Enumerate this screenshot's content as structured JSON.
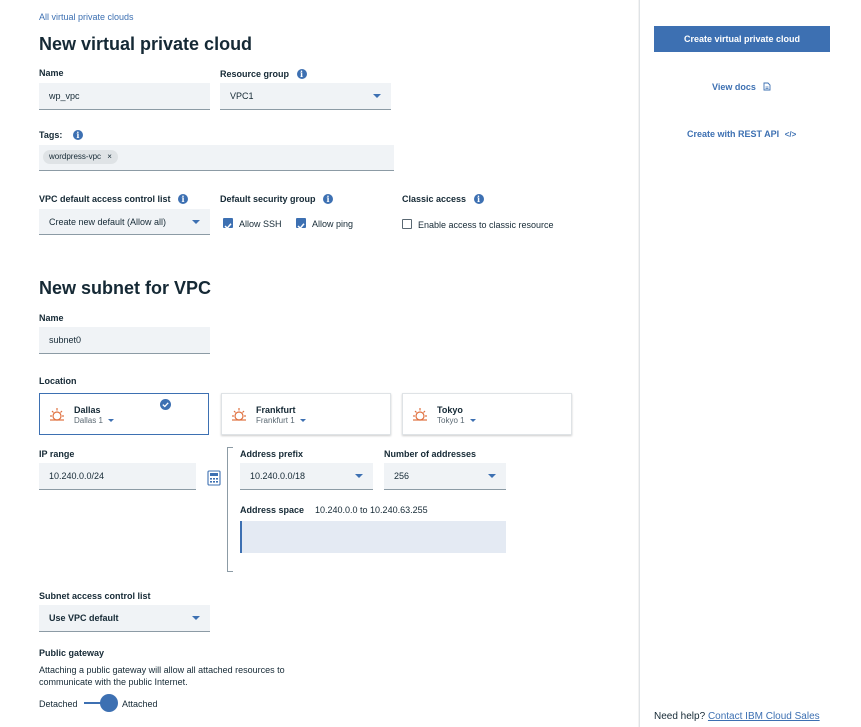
{
  "breadcrumb": "All virtual private clouds",
  "page_title": "New virtual private cloud",
  "vpc": {
    "name_label": "Name",
    "name_value": "wp_vpc",
    "resource_group_label": "Resource group",
    "resource_group_value": "VPC1",
    "tags_label": "Tags:",
    "tags": [
      "wordpress-vpc"
    ],
    "acl_label": "VPC default access control list",
    "acl_value": "Create new default (Allow all)",
    "security_group_label": "Default security group",
    "allow_ssh_label": "Allow SSH",
    "allow_ssh_checked": true,
    "allow_ping_label": "Allow ping",
    "allow_ping_checked": true,
    "classic_label": "Classic access",
    "classic_option_label": "Enable access to classic resource",
    "classic_checked": false
  },
  "subnet": {
    "section_title": "New subnet for VPC",
    "name_label": "Name",
    "name_value": "subnet0",
    "location_label": "Location",
    "locations": [
      {
        "city": "Dallas",
        "zone": "Dallas 1",
        "selected": true
      },
      {
        "city": "Frankfurt",
        "zone": "Frankfurt 1",
        "selected": false
      },
      {
        "city": "Tokyo",
        "zone": "Tokyo 1",
        "selected": false
      }
    ],
    "ip_range_label": "IP range",
    "ip_range_value": "10.240.0.0/24",
    "address_prefix_label": "Address prefix",
    "address_prefix_value": "10.240.0.0/18",
    "num_addresses_label": "Number of addresses",
    "num_addresses_value": "256",
    "address_space_label": "Address space",
    "address_space_value": "10.240.0.0 to 10.240.63.255",
    "acl_label": "Subnet access control list",
    "acl_value": "Use VPC default",
    "gateway_label": "Public gateway",
    "gateway_desc_line1": "Attaching a public gateway will allow all attached resources to",
    "gateway_desc_line2": "communicate with the public Internet.",
    "toggle_off_label": "Detached",
    "toggle_on_label": "Attached",
    "toggle_state": "Attached"
  },
  "sidebar": {
    "create_button": "Create virtual private cloud",
    "view_docs": "View docs",
    "rest_api": "Create with REST API",
    "help_prefix": "Need help?",
    "help_link": "Contact IBM Cloud Sales"
  },
  "colors": {
    "accent": "#3d70b2",
    "field_bg": "#f0f3f6",
    "text": "#152935"
  },
  "icons": {
    "info": "info-icon",
    "location": "sun-location-icon",
    "checkmark": "checkmark-circle-icon",
    "calculator": "calculator-icon",
    "launch": "launch-icon",
    "code": "code-icon",
    "tag_close": "close-icon"
  }
}
